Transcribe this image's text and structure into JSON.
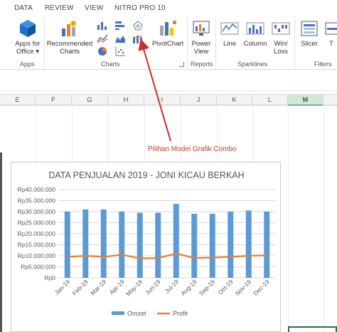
{
  "ribbon_tabs": [
    "DATA",
    "REVIEW",
    "VIEW",
    "NITRO PRO 10"
  ],
  "ribbon": {
    "apps_for_office": [
      "Apps for",
      "Office ▾"
    ],
    "apps_group": "Apps",
    "recommended_charts": [
      "Recommended",
      "Charts"
    ],
    "charts_group": "Charts",
    "pivotchart": "PivotChart",
    "power_view": [
      "Power",
      "View"
    ],
    "reports_group": "Reports",
    "sparkline_line": "Line",
    "sparkline_column": "Column",
    "sparkline_winloss": [
      "Win/",
      "Loss"
    ],
    "sparklines_group": "Sparklines",
    "slicer": "Slicer",
    "timeline": "T",
    "filters_group": "Filters",
    "accent_color": "#217346"
  },
  "columns": [
    "E",
    "F",
    "G",
    "H",
    "I",
    "J",
    "K",
    "L",
    "M"
  ],
  "selected_column": "M",
  "annotation": {
    "text": "Pilihan Model Grafik Combo",
    "color": "#c0392b"
  },
  "chart_data": {
    "type": "bar",
    "title": "DATA PENJUALAN 2019 - JONI KICAU BERKAH",
    "categories": [
      "Jan-19",
      "Feb-19",
      "Mar-19",
      "Apr-19",
      "May-19",
      "Jun-19",
      "Jul-19",
      "Aug-19",
      "Sep-19",
      "Oct-19",
      "Nov-19",
      "Dec-19"
    ],
    "series": [
      {
        "name": "Omzet",
        "kind": "bar",
        "color": "#5b9bd5",
        "values": [
          30000000,
          31000000,
          31000000,
          30000000,
          29500000,
          29500000,
          33500000,
          29000000,
          29000000,
          30000000,
          30500000,
          30000000
        ]
      },
      {
        "name": "Profit",
        "kind": "line",
        "color": "#ed7d31",
        "values": [
          9500000,
          10000000,
          9500000,
          10500000,
          8800000,
          9000000,
          11000000,
          9000000,
          9200000,
          9500000,
          10000000,
          10200000
        ]
      }
    ],
    "y_ticks": [
      "Rp0",
      "Rp5.000.000",
      "Rp10.000.000",
      "Rp15.000.000",
      "Rp20.000.000",
      "Rp25.000.000",
      "Rp30.000.000",
      "Rp35.000.000",
      "Rp40.000.000"
    ],
    "ylim": [
      0,
      40000000
    ],
    "grid": true,
    "legend_position": "bottom"
  }
}
